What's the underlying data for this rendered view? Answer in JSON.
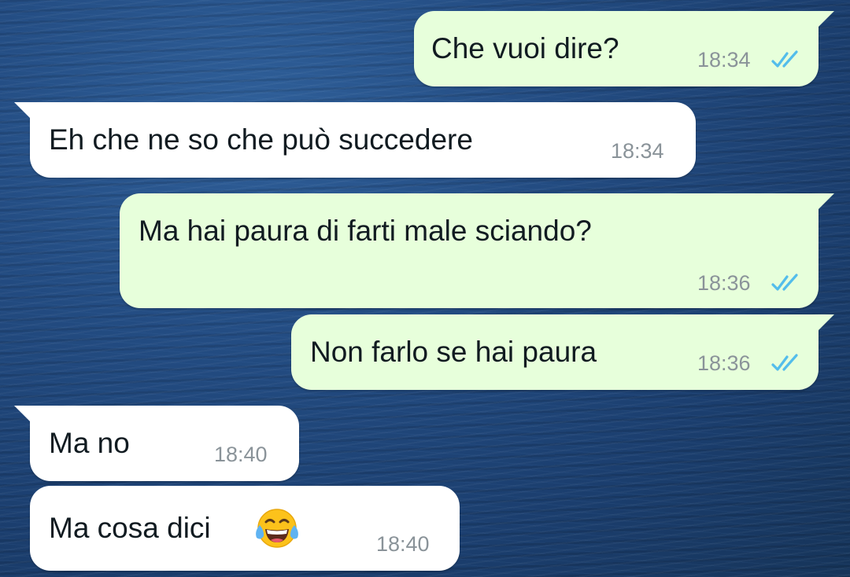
{
  "messages": [
    {
      "direction": "outgoing",
      "text": "Che vuoi dire?",
      "time": "18:34",
      "status": "read"
    },
    {
      "direction": "incoming",
      "text": "Eh che ne so che può succedere",
      "time": "18:34"
    },
    {
      "direction": "outgoing",
      "text": "Ma hai paura di farti male sciando?",
      "time": "18:36",
      "status": "read"
    },
    {
      "direction": "outgoing",
      "text": "Non farlo se hai paura",
      "time": "18:36",
      "status": "read"
    },
    {
      "direction": "incoming",
      "text": "Ma no",
      "time": "18:40"
    },
    {
      "direction": "incoming",
      "text": "Ma cosa dici",
      "emoji": "face-with-tears-of-joy",
      "time": "18:40"
    }
  ],
  "colors": {
    "outgoing_bubble": "#e7ffdb",
    "incoming_bubble": "#ffffff",
    "read_ticks": "#53bdeb",
    "timestamp": "#8a9399",
    "text": "#111b21"
  },
  "icons": {
    "read_receipt": "double-check-icon",
    "emoji": "face-with-tears-of-joy-icon"
  }
}
